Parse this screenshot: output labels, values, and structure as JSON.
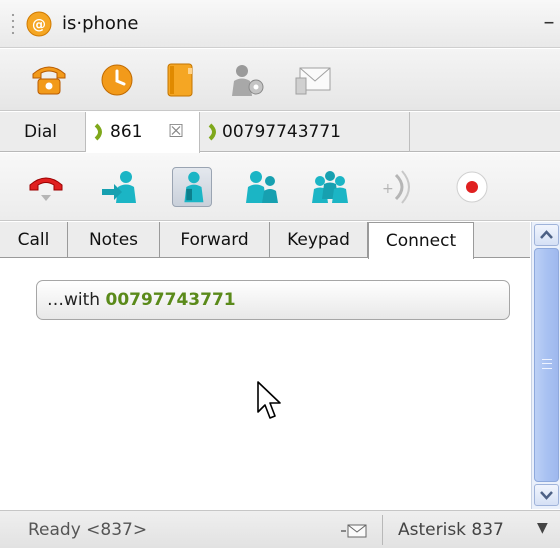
{
  "window": {
    "title": "is·phone",
    "minimize": "–"
  },
  "toolbar": {
    "items": [
      {
        "icon": "phone-icon",
        "color": "#f29a1a"
      },
      {
        "icon": "clock-icon",
        "color": "#f29a1a"
      },
      {
        "icon": "address-book-icon",
        "color": "#f5a623"
      },
      {
        "icon": "user-settings-icon",
        "color": "#9a9a9a"
      },
      {
        "icon": "message-icon",
        "color": "#b0b0b0"
      }
    ]
  },
  "call_tabs": {
    "tabs": [
      {
        "label": "Dial",
        "active": false
      },
      {
        "label": "861",
        "active": true,
        "close": "☒"
      },
      {
        "label": "00797743771",
        "active": false
      }
    ]
  },
  "call_actions": {
    "items": [
      {
        "icon": "hangup-icon",
        "color": "#e02020"
      },
      {
        "icon": "transfer-icon",
        "color": "#1bb5c5"
      },
      {
        "icon": "hold-icon",
        "color": "#1bb5c5",
        "pressed": true
      },
      {
        "icon": "forward-icon",
        "color": "#1bb5c5"
      },
      {
        "icon": "conference-icon",
        "color": "#1bb5c5"
      },
      {
        "icon": "mute-icon",
        "color": "#b5b5b5"
      },
      {
        "icon": "record-icon",
        "color": "#e02020"
      }
    ]
  },
  "sub_tabs": {
    "tabs": [
      {
        "label": "Call",
        "active": false
      },
      {
        "label": "Notes",
        "active": false
      },
      {
        "label": "Forward",
        "active": false
      },
      {
        "label": "Keypad",
        "active": false
      },
      {
        "label": "Connect",
        "active": true
      }
    ]
  },
  "connect": {
    "prefix": "…with",
    "number": "00797743771",
    "number_color": "#5a8a1a"
  },
  "status": {
    "text": "Ready <837>",
    "server": "Asterisk 837",
    "arrow": "▼"
  },
  "colors": {
    "accent": "#f29a1a",
    "teal": "#1bb5c5",
    "scrollbar": "#a9c2f2"
  }
}
